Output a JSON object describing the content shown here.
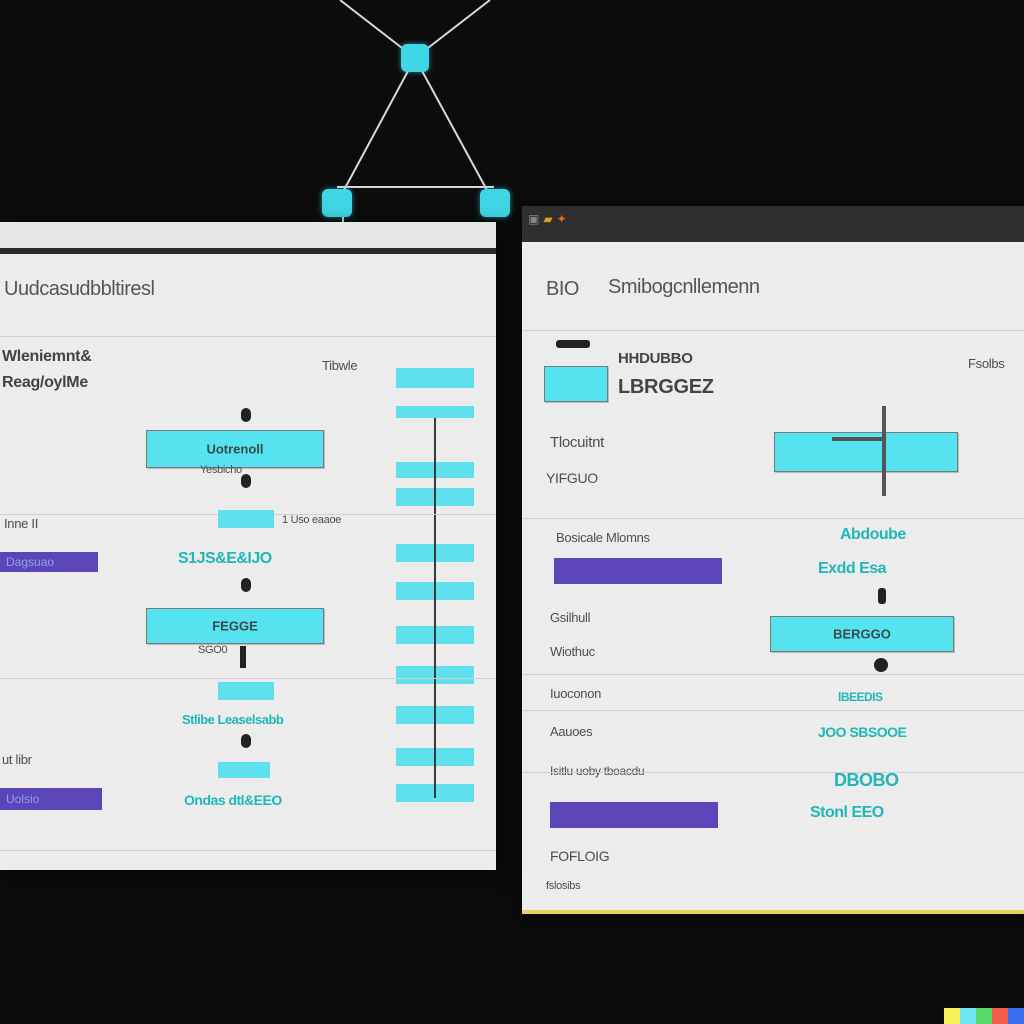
{
  "diagram": {
    "nodes": [
      "network-node-top",
      "network-node-left",
      "network-node-right"
    ]
  },
  "left_panel": {
    "title": "Uudcasudbbltiresl",
    "header_left_line1": "Wleniemnt&",
    "header_left_line2": "Reag/oylMe",
    "header_right": "Tibwle",
    "box1_label": "Uotrenoll",
    "box1_caption": "Yesbicho",
    "section2_label": "Inne II",
    "small_caption": "1 Uso eaaoe",
    "purple1_label": "Dagsuao",
    "cyan_text1": "S1JS&E&IJO",
    "box2_label": "FEGGE",
    "box2_caption": "SGO0",
    "cyan_text2": "Stlibe Leaselsabb",
    "section3_label": "ut libr",
    "purple2_label": "Uolsio",
    "cyan_text3": "Ondas dtl&EEO"
  },
  "right_panel": {
    "title_left": "BIO",
    "title_main": "Smibogcnllemenn",
    "header_label_line1": "HHDUBBO",
    "header_label_line2": "LBRGGEZ",
    "header_right": "Fsolbs",
    "row1_label": "Tlocuitnt",
    "row2_label": "YIFGUO",
    "row3_label": "Bosicale Mlomns",
    "row4_label": "Gsilhull",
    "row5_label": "Wiothuc",
    "row6_label": "Iuoconon",
    "row7_label": "Aauoes",
    "row8_label": "Isitlu uoby tboacdu",
    "row9_label": "FOFLOIG",
    "row10_label": "fslosibs",
    "cyan1": "Abdoube",
    "cyan2": "Exdd Esa",
    "box2_label": "BERGGO",
    "cyan3": "lBEEDIS",
    "cyan4": "JOO SBSOOE",
    "cyan5": "DBOBO",
    "cyan6": "Stonl EEO"
  },
  "colors": {
    "cyan": "#55e3ef",
    "purple": "#5b45b8",
    "teal_text": "#1fb7b7"
  }
}
